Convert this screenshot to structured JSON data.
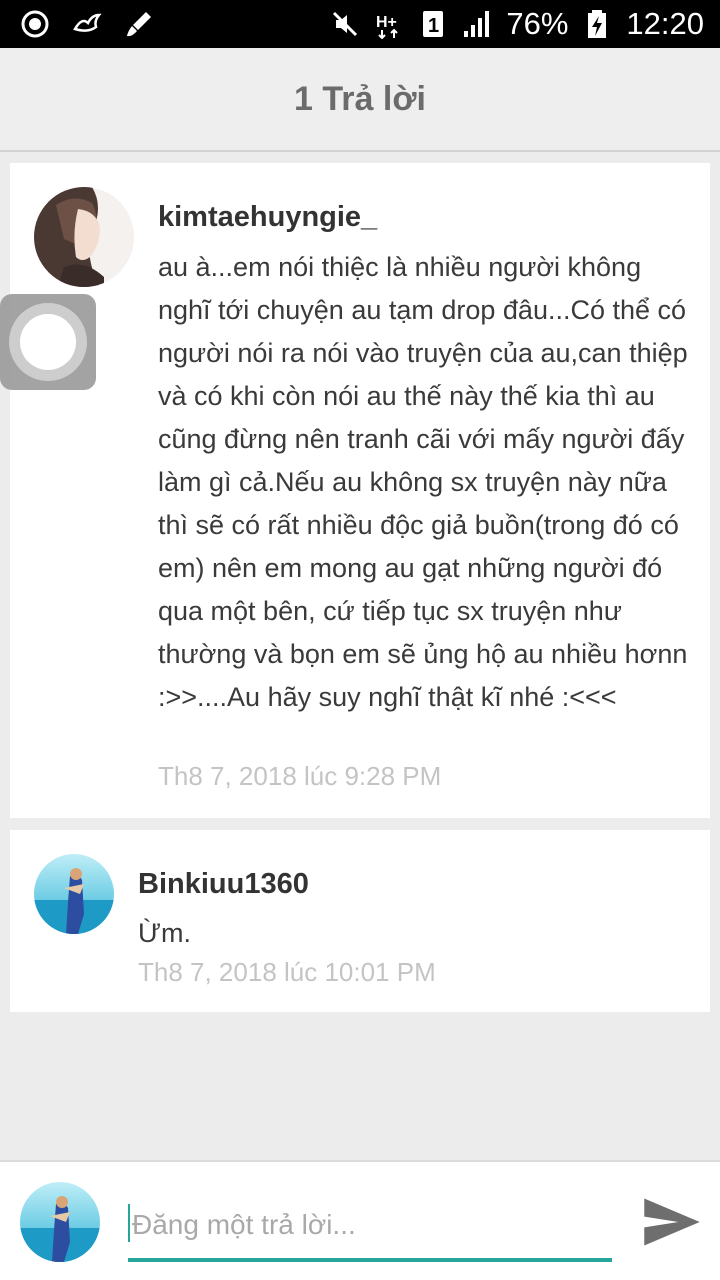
{
  "status_bar": {
    "left_icons": [
      "circle-play-icon",
      "bird-icon",
      "brush-icon"
    ],
    "right_icons": [
      "mute-icon",
      "network-h-icon",
      "sim-1-icon",
      "signal-icon",
      "battery-charging-icon"
    ],
    "battery": "76%",
    "time": "12:20"
  },
  "header": {
    "title": "1 Trả lời"
  },
  "comments": [
    {
      "username": "kimtaehuyngie_",
      "text": "au à...em nói thiệc là nhiều người không nghĩ tới chuyện au tạm drop đâu...Có thể có người nói ra nói vào truyện của au,can thiệp và có khi còn nói au thế này thế kia thì au cũng đừng nên tranh cãi với mấy người đấy làm gì cả.Nếu au không sx truyện này nữa thì sẽ có rất nhiều độc giả buồn(trong đó có em) nên em mong au gạt những người đó qua một bên, cứ tiếp tục sx truyện như thường và bọn em sẽ ủng hộ au nhiều hơnn :>>....Au hãy suy nghĩ thật kĩ nhé :<<<",
      "timestamp": "Th8 7, 2018 lúc 9:28 PM"
    },
    {
      "username": "Binkiuu1360",
      "text": "Ừm.",
      "timestamp": "Th8 7, 2018 lúc 10:01 PM"
    }
  ],
  "reply": {
    "placeholder": "Đăng một trả lời...",
    "value": ""
  },
  "colors": {
    "accent": "#26a69a",
    "background": "#ececec",
    "card": "#ffffff",
    "timestamp": "#c4c4c4"
  }
}
